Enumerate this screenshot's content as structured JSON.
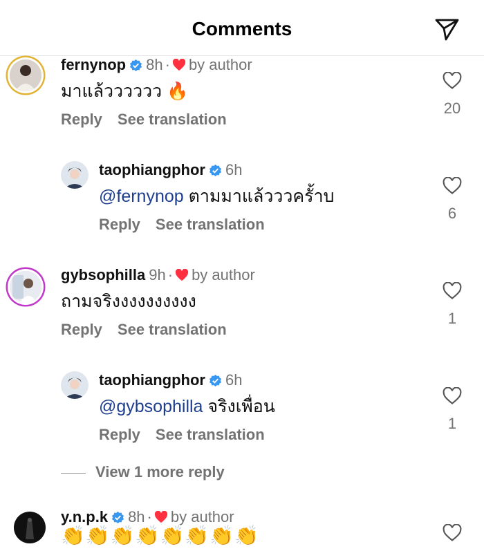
{
  "header": {
    "title": "Comments"
  },
  "comments": [
    {
      "username": "fernynop",
      "time": "8h",
      "liked_by_author": "by author",
      "text": "มาแล้วววววว 🔥",
      "reply": "Reply",
      "see_translation": "See translation",
      "likes": "20"
    },
    {
      "username": "taophiangphor",
      "time": "6h",
      "mention": "@fernynop",
      "text": " ตามมาแล้วววครั้าบ",
      "reply": "Reply",
      "see_translation": "See translation",
      "likes": "6"
    },
    {
      "username": "gybsophilla",
      "time": "9h",
      "liked_by_author": "by author",
      "text": "ถามจริงงงงงงงงงง",
      "reply": "Reply",
      "see_translation": "See translation",
      "likes": "1"
    },
    {
      "username": "taophiangphor",
      "time": "6h",
      "mention": "@gybsophilla",
      "text": " จริงเพื่อน",
      "reply": "Reply",
      "see_translation": "See translation",
      "likes": "1"
    },
    {
      "username": "y.n.p.k",
      "time": "8h",
      "liked_by_author": "by author",
      "text": "👏👏👏👏👏👏👏👏"
    }
  ],
  "view_more_replies": "View 1 more reply",
  "icons": {
    "send": "send-icon",
    "like": "heart-outline-icon",
    "verified": "verified-badge-icon",
    "author_heart": "red-heart-icon"
  },
  "colors": {
    "verified": "#3897f0",
    "author_heart": "#ff3040",
    "mention": "#1e3e8f",
    "secondary_text": "#737373"
  }
}
